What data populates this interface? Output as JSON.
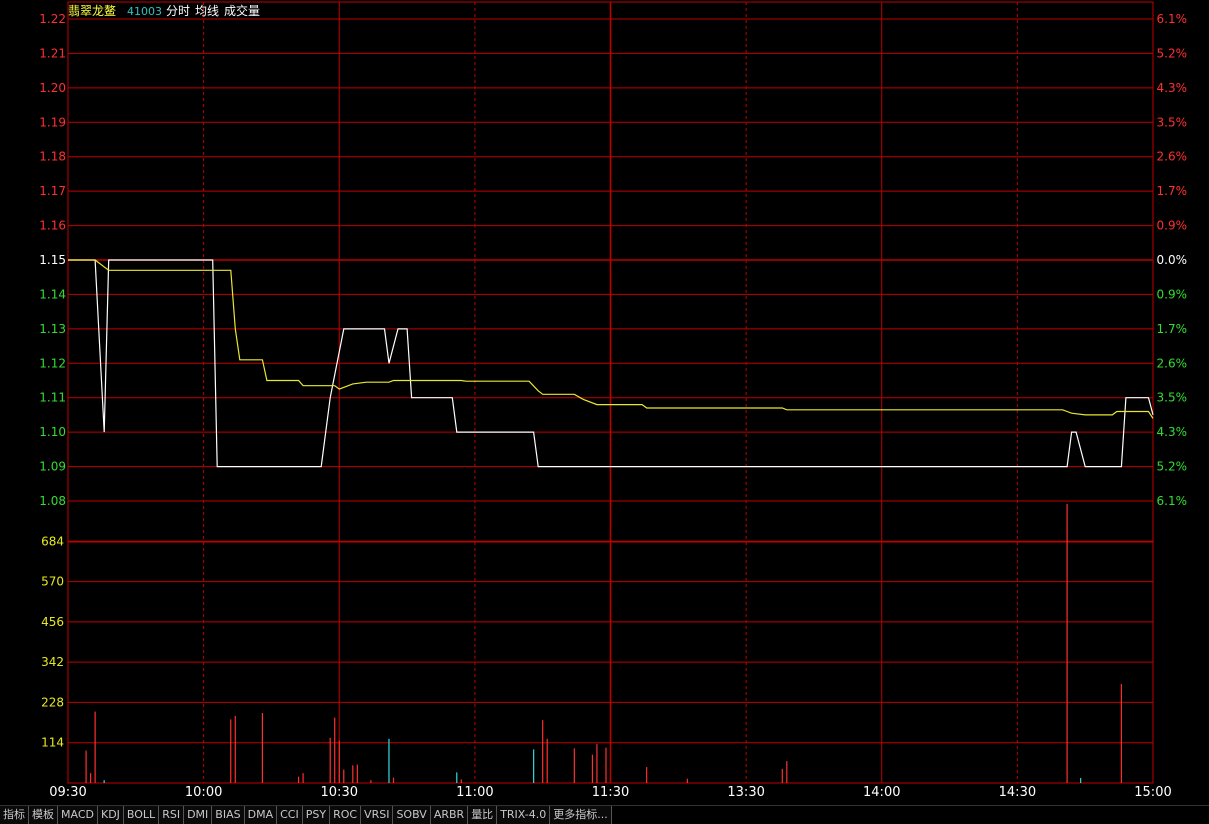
{
  "header": {
    "name": "翡翠龙鳌",
    "code": "41003",
    "labels": [
      "分时",
      "均线",
      "成交量"
    ]
  },
  "colors": {
    "grid": "#c00000",
    "up": "#ff3030",
    "down": "#33dd33",
    "flat": "#ffffff",
    "price_line": "#ffffff",
    "avg_line": "#e8e830",
    "volume_axis": "#e8e820",
    "volume_up": "#ff3030",
    "volume_down": "#30dddd",
    "time_label": "#ffffff"
  },
  "toolbar": [
    "指标",
    "模板",
    "MACD",
    "KDJ",
    "BOLL",
    "RSI",
    "DMI",
    "BIAS",
    "DMA",
    "CCI",
    "PSY",
    "ROC",
    "VRSI",
    "SOBV",
    "ARBR",
    "量比",
    "TRIX-4.0",
    "更多指标..."
  ],
  "chart_data": {
    "type": "line",
    "prev_close": 1.15,
    "price_axis": {
      "ylim": [
        1.08,
        1.22
      ],
      "ticks": [
        "1.22",
        "1.21",
        "1.20",
        "1.19",
        "1.18",
        "1.17",
        "1.16",
        "1.15",
        "1.14",
        "1.13",
        "1.12",
        "1.11",
        "1.10",
        "1.09",
        "1.08"
      ],
      "pct_ticks": [
        "6.1%",
        "5.2%",
        "4.3%",
        "3.5%",
        "2.6%",
        "1.7%",
        "0.9%",
        "0.0%",
        "0.9%",
        "1.7%",
        "2.6%",
        "3.5%",
        "4.3%",
        "5.2%",
        "6.1%"
      ]
    },
    "volume_axis": {
      "ylim": [
        0,
        798
      ],
      "ticks": [
        "684",
        "570",
        "456",
        "342",
        "228",
        "114"
      ]
    },
    "time_axis": {
      "minutes_total": 240,
      "labels": [
        {
          "label": "09:30",
          "minute": 0
        },
        {
          "label": "10:00",
          "minute": 30
        },
        {
          "label": "10:30",
          "minute": 60
        },
        {
          "label": "11:00",
          "minute": 90
        },
        {
          "label": "11:30",
          "minute": 120
        },
        {
          "label": "13:30",
          "minute": 150
        },
        {
          "label": "14:00",
          "minute": 180
        },
        {
          "label": "14:30",
          "minute": 210
        },
        {
          "label": "15:00",
          "minute": 240
        }
      ]
    },
    "series": [
      {
        "kind": "price",
        "points": [
          [
            0,
            1.15
          ],
          [
            6,
            1.15
          ],
          [
            8,
            1.1
          ],
          [
            9,
            1.15
          ],
          [
            32,
            1.15
          ],
          [
            33,
            1.09
          ],
          [
            56,
            1.09
          ],
          [
            58,
            1.11
          ],
          [
            61,
            1.13
          ],
          [
            70,
            1.13
          ],
          [
            71,
            1.12
          ],
          [
            73,
            1.13
          ],
          [
            75,
            1.13
          ],
          [
            76,
            1.11
          ],
          [
            85,
            1.11
          ],
          [
            86,
            1.1
          ],
          [
            103,
            1.1
          ],
          [
            104,
            1.09
          ],
          [
            221,
            1.09
          ],
          [
            222,
            1.1
          ],
          [
            223,
            1.1
          ],
          [
            225,
            1.09
          ],
          [
            233,
            1.09
          ],
          [
            234,
            1.11
          ],
          [
            239,
            1.11
          ],
          [
            240,
            1.105
          ]
        ]
      },
      {
        "kind": "average",
        "points": [
          [
            0,
            1.15
          ],
          [
            6,
            1.15
          ],
          [
            9,
            1.147
          ],
          [
            36,
            1.147
          ],
          [
            37,
            1.13
          ],
          [
            38,
            1.121
          ],
          [
            43,
            1.121
          ],
          [
            44,
            1.115
          ],
          [
            51,
            1.115
          ],
          [
            52,
            1.1135
          ],
          [
            59,
            1.1135
          ],
          [
            60,
            1.1125
          ],
          [
            63,
            1.114
          ],
          [
            66,
            1.1145
          ],
          [
            71,
            1.1145
          ],
          [
            72,
            1.115
          ],
          [
            87,
            1.115
          ],
          [
            88,
            1.1148
          ],
          [
            102,
            1.1148
          ],
          [
            104,
            1.112
          ],
          [
            105,
            1.111
          ],
          [
            112,
            1.111
          ],
          [
            114,
            1.1095
          ],
          [
            117,
            1.108
          ],
          [
            127,
            1.108
          ],
          [
            128,
            1.107
          ],
          [
            158,
            1.107
          ],
          [
            159,
            1.1065
          ],
          [
            220,
            1.1065
          ],
          [
            221,
            1.106
          ],
          [
            222,
            1.1055
          ],
          [
            225,
            1.105
          ],
          [
            231,
            1.105
          ],
          [
            232,
            1.106
          ],
          [
            239,
            1.106
          ],
          [
            240,
            1.104
          ]
        ]
      }
    ],
    "volume": [
      {
        "minute": 4,
        "value": 92,
        "dir": "up"
      },
      {
        "minute": 5,
        "value": 28,
        "dir": "up"
      },
      {
        "minute": 6,
        "value": 202,
        "dir": "up"
      },
      {
        "minute": 8,
        "value": 8,
        "dir": "down"
      },
      {
        "minute": 36,
        "value": 180,
        "dir": "up"
      },
      {
        "minute": 37,
        "value": 190,
        "dir": "up"
      },
      {
        "minute": 43,
        "value": 198,
        "dir": "up"
      },
      {
        "minute": 51,
        "value": 18,
        "dir": "up"
      },
      {
        "minute": 52,
        "value": 28,
        "dir": "up"
      },
      {
        "minute": 58,
        "value": 128,
        "dir": "up"
      },
      {
        "minute": 59,
        "value": 185,
        "dir": "up"
      },
      {
        "minute": 60,
        "value": 120,
        "dir": "up"
      },
      {
        "minute": 61,
        "value": 38,
        "dir": "up"
      },
      {
        "minute": 63,
        "value": 50,
        "dir": "up"
      },
      {
        "minute": 64,
        "value": 52,
        "dir": "up"
      },
      {
        "minute": 67,
        "value": 8,
        "dir": "up"
      },
      {
        "minute": 71,
        "value": 125,
        "dir": "down"
      },
      {
        "minute": 72,
        "value": 15,
        "dir": "up"
      },
      {
        "minute": 86,
        "value": 30,
        "dir": "down"
      },
      {
        "minute": 87,
        "value": 10,
        "dir": "up"
      },
      {
        "minute": 103,
        "value": 95,
        "dir": "down"
      },
      {
        "minute": 105,
        "value": 178,
        "dir": "up"
      },
      {
        "minute": 106,
        "value": 125,
        "dir": "up"
      },
      {
        "minute": 112,
        "value": 98,
        "dir": "up"
      },
      {
        "minute": 116,
        "value": 80,
        "dir": "up"
      },
      {
        "minute": 117,
        "value": 110,
        "dir": "up"
      },
      {
        "minute": 119,
        "value": 100,
        "dir": "up"
      },
      {
        "minute": 128,
        "value": 45,
        "dir": "up"
      },
      {
        "minute": 137,
        "value": 12,
        "dir": "up"
      },
      {
        "minute": 158,
        "value": 40,
        "dir": "up"
      },
      {
        "minute": 159,
        "value": 62,
        "dir": "up"
      },
      {
        "minute": 221,
        "value": 790,
        "dir": "up"
      },
      {
        "minute": 224,
        "value": 14,
        "dir": "down"
      },
      {
        "minute": 233,
        "value": 280,
        "dir": "up"
      }
    ]
  }
}
